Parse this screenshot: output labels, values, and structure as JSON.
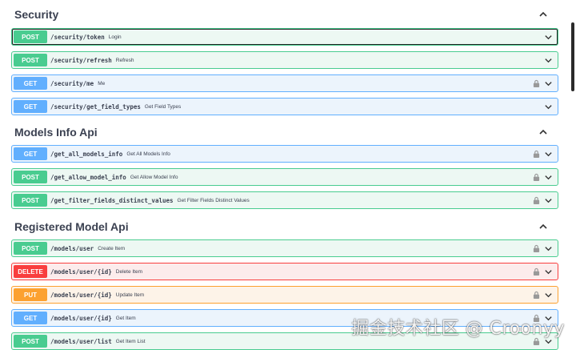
{
  "sections": [
    {
      "title": "Security",
      "operations": [
        {
          "method": "POST",
          "path": "/security/token",
          "summary": "Login",
          "locked": false
        },
        {
          "method": "POST",
          "path": "/security/refresh",
          "summary": "Refresh",
          "locked": false
        },
        {
          "method": "GET",
          "path": "/security/me",
          "summary": "Me",
          "locked": true
        },
        {
          "method": "GET",
          "path": "/security/get_field_types",
          "summary": "Get Field Types",
          "locked": false
        }
      ]
    },
    {
      "title": "Models Info Api",
      "operations": [
        {
          "method": "GET",
          "path": "/get_all_models_info",
          "summary": "Get All Models Info",
          "locked": true
        },
        {
          "method": "POST",
          "path": "/get_allow_model_info",
          "summary": "Get Allow Model Info",
          "locked": true
        },
        {
          "method": "POST",
          "path": "/get_filter_fields_distinct_values",
          "summary": "Get Filter Fields Distinct Values",
          "locked": true
        }
      ]
    },
    {
      "title": "Registered Model Api",
      "operations": [
        {
          "method": "POST",
          "path": "/models/user",
          "summary": "Create Item",
          "locked": true
        },
        {
          "method": "DELETE",
          "path": "/models/user/{id}",
          "summary": "Delete Item",
          "locked": true
        },
        {
          "method": "PUT",
          "path": "/models/user/{id}",
          "summary": "Update Item",
          "locked": true
        },
        {
          "method": "GET",
          "path": "/models/user/{id}",
          "summary": "Get Item",
          "locked": true
        },
        {
          "method": "POST",
          "path": "/models/user/list",
          "summary": "Get Item List",
          "locked": true
        }
      ]
    }
  ],
  "watermark": "掘金技术社区 @ Croonyy",
  "colors": {
    "post": "#49cc90",
    "get": "#61affe",
    "put": "#fca130",
    "delete": "#f93e3e"
  }
}
